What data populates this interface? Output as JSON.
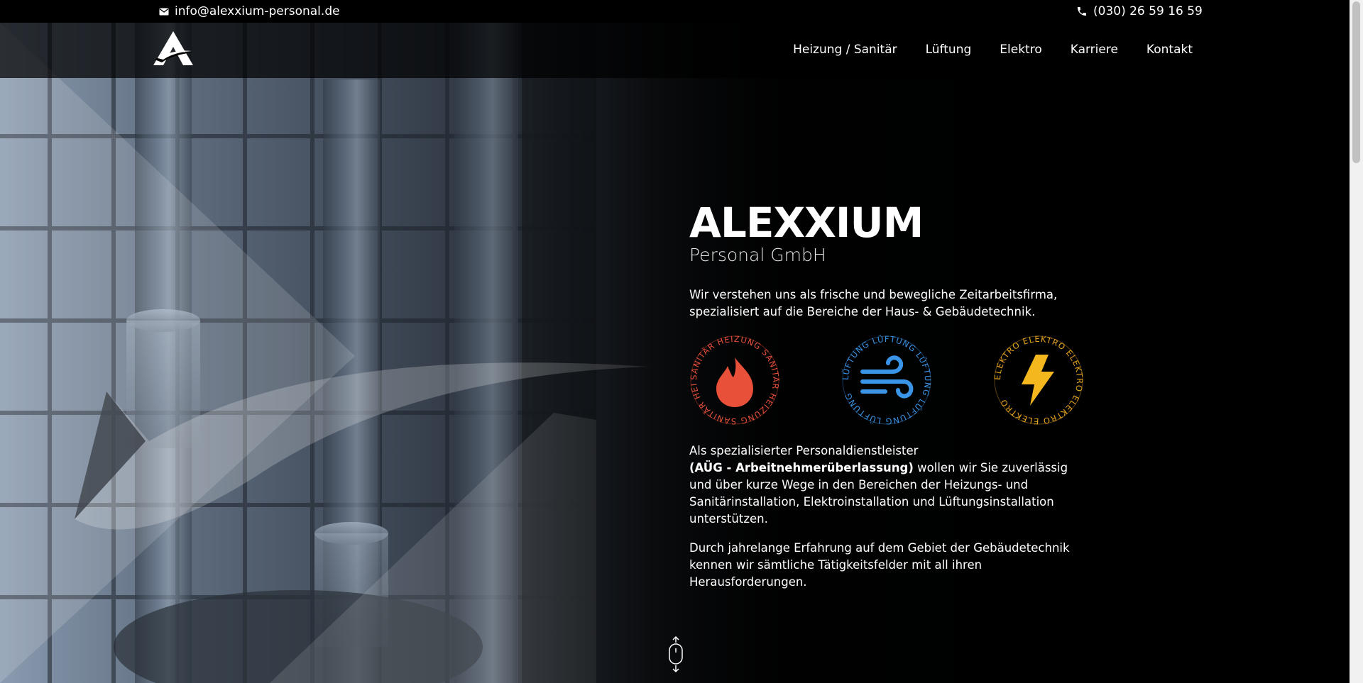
{
  "topbar": {
    "email": "info@alexxium-personal.de",
    "phone": "(030) 26 59 16 59",
    "email_icon": "mail-icon",
    "phone_icon": "phone-icon"
  },
  "nav": {
    "logo": "alexxium-logo",
    "items": [
      "Heizung / Sanitär",
      "Lüftung",
      "Elektro",
      "Karriere",
      "Kontakt"
    ]
  },
  "hero": {
    "brand": "ALEXXIUM",
    "subtitle": "Personal GmbH",
    "intro": "Wir verstehen uns als frische und bewegliche Zeitarbeitsfirma, spezialisiert auf die Bereiche der Haus- & Gebäudetechnik.",
    "badges": [
      {
        "ring_text": "SANITÄR HEIZUNG SANITÄR HEIZUNG SANITÄR HEIZUNG",
        "icon": "flame-icon",
        "color": "#e8503a"
      },
      {
        "ring_text": "LÜFTUNG LÜFTUNG LÜFTUNG LÜFTUNG LÜFTUNG",
        "icon": "wind-icon",
        "color": "#3a95e8"
      },
      {
        "ring_text": "ELEKTRO ELEKTRO ELEKTRO ELEKTRO ELEKTRO",
        "icon": "lightning-icon",
        "color": "#e8a51e"
      }
    ],
    "para1_start": "Als spezialisierter Personaldienstleister",
    "para1_bold": "(AÜG - Arbeitnehmerüberlassung)",
    "para1_rest": " wollen wir Sie zuverlässig und über kurze Wege in den Bereichen der Heizungs- und Sanitärinstallation, Elektroinstallation und Lüftungsinstallation unterstützen.",
    "para2": "Durch jahrelange Erfahrung auf dem Gebiet der Gebäudetechnik kennen wir sämtliche Tätigkeitsfelder mit all ihren Herausforderungen.",
    "scroll_icon": "mouse-scroll-icon"
  },
  "colors": {
    "heat": "#e8503a",
    "air": "#3a95e8",
    "power": "#e8a51e"
  }
}
